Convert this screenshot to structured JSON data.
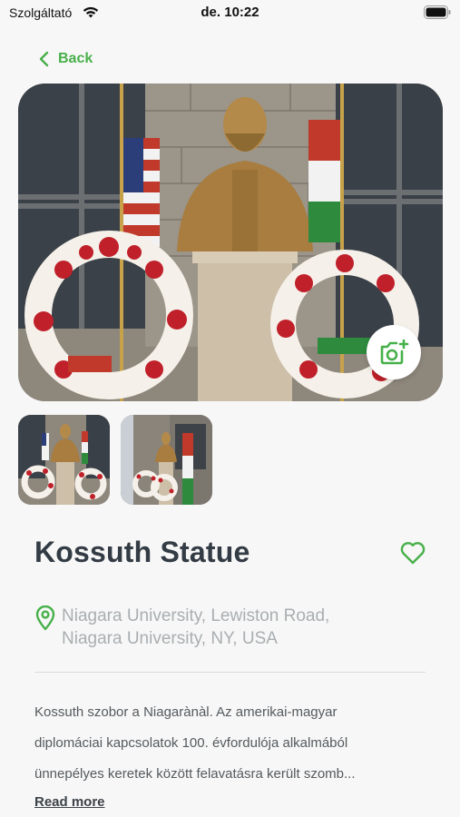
{
  "status_bar": {
    "carrier": "Szolgáltató",
    "time": "de. 10:22",
    "wifi_icon": "wifi-icon",
    "battery_icon": "battery-icon"
  },
  "nav": {
    "back_label": "Back",
    "back_icon": "chevron-left-icon"
  },
  "gallery": {
    "add_photo_icon": "add-photo-icon",
    "thumbnails": 2
  },
  "place": {
    "title": "Kossuth Statue",
    "favorite_icon": "heart-icon",
    "address_line1": "Niagara University, Lewiston Road,",
    "address_line2": "Niagara University, NY, USA",
    "description_line1": "Kossuth szobor a Niagarànàl. Az amerikai-magyar",
    "description_line2": "diplomáciai kapcsolatok 100. évfordulója alkalmából",
    "description_line3": "ünnepélyes keretek között felavatásra került szomb...",
    "read_more": "Read more"
  },
  "colors": {
    "accent": "#48b04a",
    "title": "#333b44",
    "muted": "#a9aeb1",
    "background": "#f7f7f7"
  }
}
